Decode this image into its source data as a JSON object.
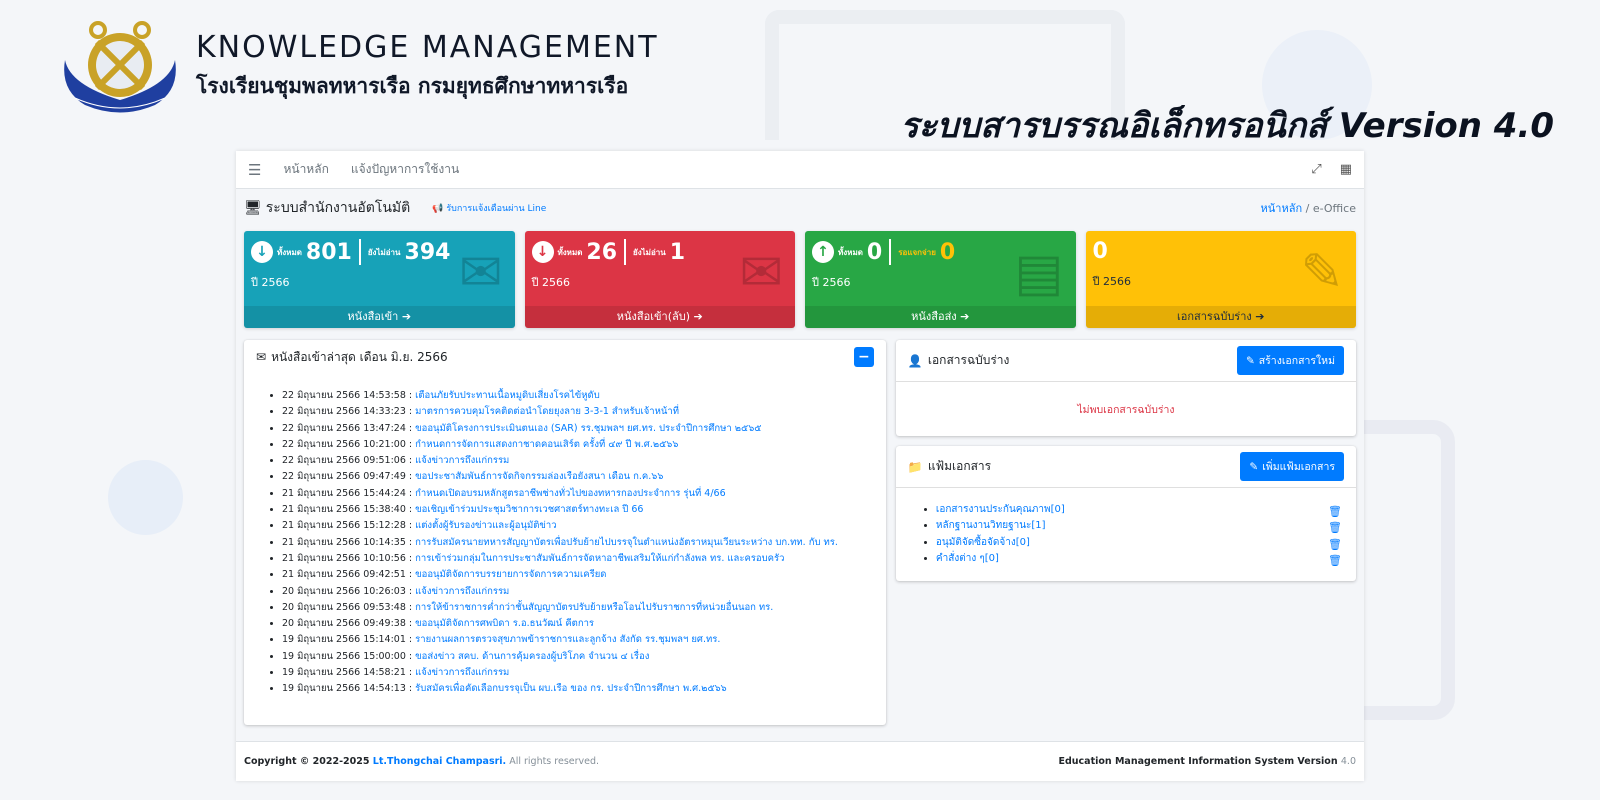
{
  "brand": {
    "title": "KNOWLEDGE MANAGEMENT",
    "subtitle": "โรงเรียนชุมพลทหารเรือ กรมยุทธศึกษาทหารเรือ",
    "logo_text": "โรงเรียนชุมพลทหารเรือ",
    "system_title": "ระบบสารบรรณอิเล็กทรอนิกส์ Version 4.0"
  },
  "navbar": {
    "menu_icon": "☰",
    "links": [
      "หน้าหลัก",
      "แจ้งปัญหาการใช้งาน"
    ],
    "expand_icon": "⤢",
    "grid_icon": "▦"
  },
  "content_header": {
    "title": "ระบบสำนักงานอัตโนมัติ",
    "line_link": "รับการแจ้งเตือนผ่าน Line",
    "breadcrumb_home": "หน้าหลัก",
    "breadcrumb_sep": "/",
    "breadcrumb_current": "e-Office"
  },
  "boxes": [
    {
      "label_total": "ทั้งหมด",
      "total": "801",
      "label_unread": "ยังไม่อ่าน",
      "unread": "394",
      "year": "ปี 2566",
      "footer": "หนังสือเข้า ➔",
      "arrow": "↓",
      "color": "#17a2b8"
    },
    {
      "label_total": "ทั้งหมด",
      "total": "26",
      "label_unread": "ยังไม่อ่าน",
      "unread": "1",
      "year": "ปี 2566",
      "footer": "หนังสือเข้า(ลับ) ➔",
      "arrow": "↓",
      "color": "#dc3545"
    },
    {
      "label_total": "ทั้งหมด",
      "total": "0",
      "label_unread": "รอแจกจ่าย",
      "unread": "0",
      "year": "ปี 2566",
      "footer": "หนังสือส่ง ➔",
      "arrow": "↑",
      "color": "#28a745"
    },
    {
      "total": "0",
      "year": "ปี 2566",
      "footer": "เอกสารฉบับร่าง ➔",
      "color": "#ffc107"
    }
  ],
  "news_card": {
    "title": "หนังสือเข้าล่าสุด เดือน มิ.ย. 2566",
    "collapse_label": "−",
    "items": [
      {
        "date": "22 มิถุนายน 2566 14:53:58 : ",
        "title": "เตือนภัยรับประทานเนื้อหมูดิบเสี่ยงโรคไข้หูดับ"
      },
      {
        "date": "22 มิถุนายน 2566 14:33:23 : ",
        "title": "มาตรการควบคุมโรคติดต่อนำโดยยุงลาย 3-3-1 สำหรับเจ้าหน้าที่"
      },
      {
        "date": "22 มิถุนายน 2566 13:47:24 : ",
        "title": "ขออนุมัติโครงการประเมินตนเอง (SAR) รร.ชุมพลฯ ยศ.ทร. ประจำปีการศึกษา ๒๕๖๕"
      },
      {
        "date": "22 มิถุนายน 2566 10:21:00 : ",
        "title": "กำหนดการจัดการแสดงกาชาดคอนเสิร์ต ครั้งที่ ๔๙ ปี พ.ศ.๒๕๖๖"
      },
      {
        "date": "22 มิถุนายน 2566 09:51:06 : ",
        "title": "แจ้งข่าวการถึงแก่กรรม"
      },
      {
        "date": "22 มิถุนายน 2566 09:47:49 : ",
        "title": "ขอประชาสัมพันธ์การจัดกิจกรรมล่องเรือยังสนา เดือน ก.ค.๖๖"
      },
      {
        "date": "21 มิถุนายน 2566 15:44:24 : ",
        "title": "กำหนดเปิดอบรมหลักสูตรอาชีพช่างทั่วไปของทหารกองประจำการ รุ่นที่ 4/66"
      },
      {
        "date": "21 มิถุนายน 2566 15:38:40 : ",
        "title": "ขอเชิญเข้าร่วมประชุมวิชาการเวชศาสตร์ทางทะเล ปี 66"
      },
      {
        "date": "21 มิถุนายน 2566 15:12:28 : ",
        "title": "แต่งตั้งผู้รับรองข่าวและผู้อนุมัติข่าว"
      },
      {
        "date": "21 มิถุนายน 2566 10:14:35 : ",
        "title": "การรับสมัครนายทหารสัญญาบัตรเพื่อปรับย้ายไปบรรจุในตำแหน่งอัตราหมุนเวียนระหว่าง บก.ทท. กับ ทร."
      },
      {
        "date": "21 มิถุนายน 2566 10:10:56 : ",
        "title": "การเข้าร่วมกลุ่มในการประชาสัมพันธ์การจัดหาอาชีพเสริมให้แก่กำลังพล ทร. และครอบครัว"
      },
      {
        "date": "21 มิถุนายน 2566 09:42:51 : ",
        "title": "ขออนุมัติจัดการบรรยายการจัดการความเครียด"
      },
      {
        "date": "20 มิถุนายน 2566 10:26:03 : ",
        "title": "แจ้งข่าวการถึงแก่กรรม"
      },
      {
        "date": "20 มิถุนายน 2566 09:53:48 : ",
        "title": "การให้ข้าราชการค่ำกว่าชั้นสัญญาบัตรปรับย้ายหรือโอนไปรับราชการที่หน่วยอื่นนอก ทร."
      },
      {
        "date": "20 มิถุนายน 2566 09:49:38 : ",
        "title": "ขออนุมัติจัดการศพบิดา ร.อ.ธนวัฒน์ คีตการ"
      },
      {
        "date": "19 มิถุนายน 2566 15:14:01 : ",
        "title": "รายงานผลการตรวจสุขภาพข้าราชการและลูกจ้าง สังกัด รร.ชุมพลฯ ยศ.ทร."
      },
      {
        "date": "19 มิถุนายน 2566 15:00:00 : ",
        "title": "ขอส่งข่าว สคบ. ด้านการคุ้มครองผู้บริโภค จำนวน ๔ เรื่อง"
      },
      {
        "date": "19 มิถุนายน 2566 14:58:21 : ",
        "title": "แจ้งข่าวการถึงแก่กรรม"
      },
      {
        "date": "19 มิถุนายน 2566 14:54:13 : ",
        "title": "รับสมัครเพื่อคัดเลือกบรรจุเป็น ผบ.เรือ ของ กร. ประจำปีการศึกษา พ.ศ.๒๕๖๖"
      }
    ]
  },
  "draft_card": {
    "title": "เอกสารฉบับร่าง",
    "button": "สร้างเอกสารใหม่",
    "empty": "ไม่พบเอกสารฉบับร่าง"
  },
  "folder_card": {
    "title": "แฟ้มเอกสาร",
    "button": "เพิ่มแฟ้มเอกสาร",
    "items": [
      "เอกสารงานประกันคุณภาพ[0]",
      "หลักฐานงานวิทยฐานะ[1]",
      "อนุมัติจัดซื้อจัดจ้าง[0]",
      "คำสั่งต่าง ๆ[0]"
    ]
  },
  "footer": {
    "copyright": "Copyright © 2022-2025 ",
    "author": "Lt.Thongchai Champasri.",
    "rights": " All rights reserved.",
    "system": "Education Management Information System Version ",
    "version": "4.0"
  }
}
